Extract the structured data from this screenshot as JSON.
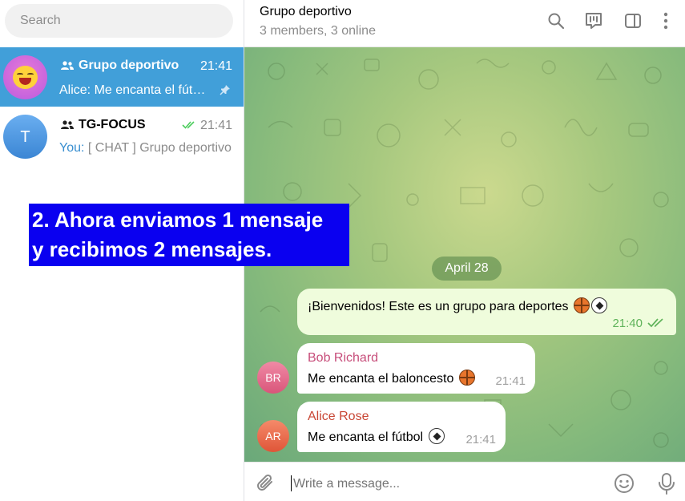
{
  "sidebar": {
    "search_placeholder": "Search",
    "chats": [
      {
        "title": "Grupo deportivo",
        "time": "21:41",
        "preview": "Alice: Me encanta el fútbol ⚽",
        "icon": "group-icon",
        "pinned": true,
        "avatar_icon": "laughing-face-emoji"
      },
      {
        "title": "TG-FOCUS",
        "time": "21:41",
        "preview_prefix": "You:",
        "preview": " [ CHAT ] Grupo deportivo",
        "icon": "group-icon",
        "status": "read",
        "avatar_letter": "T"
      }
    ]
  },
  "annotation": {
    "line1": "2. Ahora enviamos 1 mensaje",
    "line2": "y recibimos 2 mensajes."
  },
  "header": {
    "title": "Grupo deportivo",
    "subtitle": "3 members, 3 online",
    "icons": [
      "search-icon",
      "topics-icon",
      "sidebar-toggle-icon",
      "more-vertical-icon"
    ]
  },
  "conversation": {
    "date": "April 28",
    "messages": [
      {
        "direction": "out",
        "text": "¡Bienvenidos! Este es un grupo para deportes",
        "emojis": [
          "basketball",
          "soccer-ball"
        ],
        "time": "21:40",
        "status": "read"
      },
      {
        "direction": "in",
        "sender": "Bob Richard",
        "sender_initials": "BR",
        "sender_color": "#c74d7a",
        "text": "Me encanta el baloncesto",
        "emojis": [
          "basketball"
        ],
        "time": "21:41"
      },
      {
        "direction": "in",
        "sender": "Alice Rose",
        "sender_initials": "AR",
        "sender_color": "#c94735",
        "text": "Me encanta el fútbol",
        "emojis": [
          "soccer-ball"
        ],
        "time": "21:41"
      }
    ]
  },
  "composer": {
    "placeholder": "Write a message..."
  },
  "colors": {
    "accent": "#419fd9",
    "outgoing_bubble": "#effcdc",
    "read_check": "#4dcd5e",
    "annotation_bg": "#0a00f0"
  }
}
